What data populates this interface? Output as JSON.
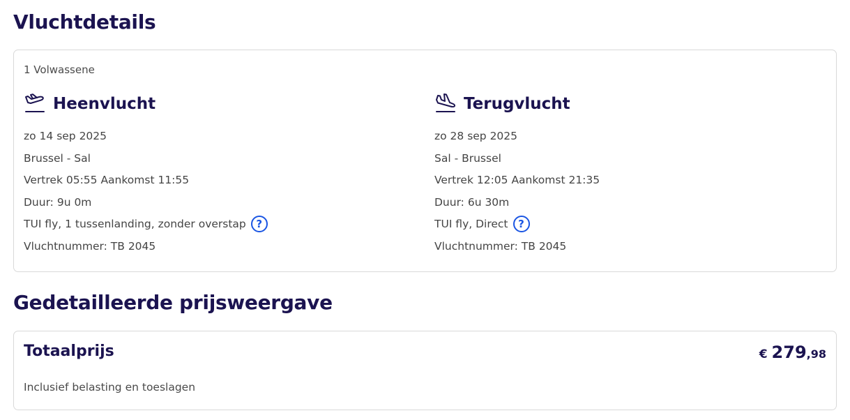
{
  "flight_details": {
    "title": "Vluchtdetails",
    "passengers": "1 Volwassene",
    "outbound": {
      "icon": "plane-departure-icon",
      "title": "Heenvlucht",
      "date": "zo 14 sep 2025",
      "route": "Brussel - Sal",
      "times": "Vertrek 05:55 Aankomst 11:55",
      "duration": "Duur: 9u 0m",
      "carrier": "TUI fly, 1 tussenlanding, zonder overstap",
      "flight_number": "Vluchtnummer: TB 2045"
    },
    "return": {
      "icon": "plane-arrival-icon",
      "title": "Terugvlucht",
      "date": "zo 28 sep 2025",
      "route": "Sal - Brussel",
      "times": "Vertrek 12:05 Aankomst 21:35",
      "duration": "Duur: 6u 30m",
      "carrier": "TUI fly, Direct",
      "flight_number": "Vluchtnummer: TB 2045"
    },
    "help_icon": "?"
  },
  "price_details": {
    "title": "Gedetailleerde prijsweergave",
    "total_label": "Totaalprijs",
    "currency": "€",
    "price_int": "279",
    "price_dec": ",98",
    "note": "Inclusief belasting en toeslagen"
  },
  "colors": {
    "heading": "#1b1350",
    "accent": "#1a55e3",
    "border": "#d9d9d9"
  }
}
